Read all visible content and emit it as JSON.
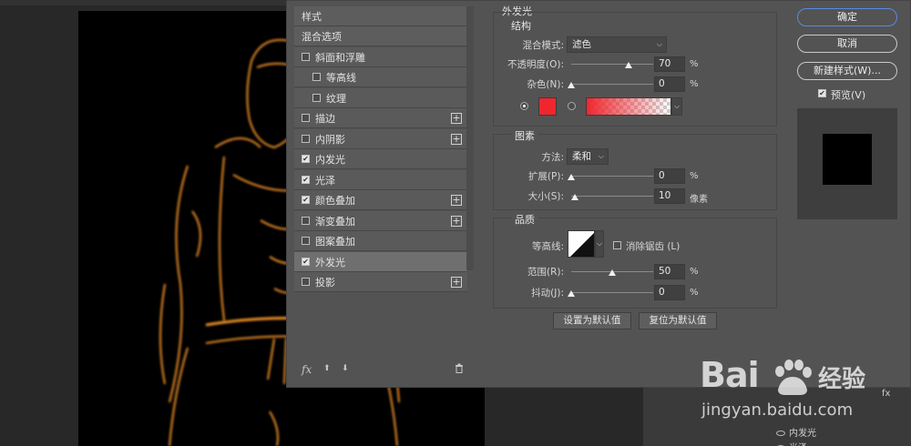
{
  "styles_list": {
    "items": [
      {
        "label": "样式",
        "type": "header"
      },
      {
        "label": "混合选项",
        "type": "header"
      },
      {
        "label": "斜面和浮雕",
        "checked": false,
        "plus": false,
        "indent": false
      },
      {
        "label": "等高线",
        "checked": false,
        "plus": false,
        "indent": true
      },
      {
        "label": "纹理",
        "checked": false,
        "plus": false,
        "indent": true
      },
      {
        "label": "描边",
        "checked": false,
        "plus": true,
        "indent": false
      },
      {
        "label": "内阴影",
        "checked": false,
        "plus": true,
        "indent": false
      },
      {
        "label": "内发光",
        "checked": true,
        "plus": false,
        "indent": false
      },
      {
        "label": "光泽",
        "checked": true,
        "plus": false,
        "indent": false
      },
      {
        "label": "颜色叠加",
        "checked": true,
        "plus": true,
        "indent": false
      },
      {
        "label": "渐变叠加",
        "checked": false,
        "plus": true,
        "indent": false
      },
      {
        "label": "图案叠加",
        "checked": false,
        "plus": false,
        "indent": false
      },
      {
        "label": "外发光",
        "checked": true,
        "plus": false,
        "indent": false,
        "selected": true
      },
      {
        "label": "投影",
        "checked": false,
        "plus": true,
        "indent": false
      }
    ],
    "footer": {
      "fx": "fx",
      "up": "⬆",
      "down": "⬇",
      "trash": "🗑"
    }
  },
  "panel": {
    "title": "外发光",
    "structure": {
      "title": "结构",
      "blend_mode_label": "混合模式:",
      "blend_mode_value": "滤色",
      "opacity_label": "不透明度(O):",
      "opacity_value": "70",
      "opacity_unit": "%",
      "opacity_level": 0.7,
      "noise_label": "杂色(N):",
      "noise_value": "0",
      "noise_unit": "%",
      "noise_level": 0,
      "color": "#f0262e",
      "gradient_from": "#f0262e",
      "solid_color_selected": true
    },
    "elements": {
      "title": "图素",
      "method_label": "方法:",
      "method_value": "柔和",
      "spread_label": "扩展(P):",
      "spread_value": "0",
      "spread_unit": "%",
      "spread_level": 0,
      "size_label": "大小(S):",
      "size_value": "10",
      "size_unit": "像素",
      "size_level": 0.04
    },
    "quality": {
      "title": "品质",
      "contour_label": "等高线:",
      "anti_alias_label": "消除锯齿 (L)",
      "anti_alias_checked": false,
      "range_label": "范围(R):",
      "range_value": "50",
      "range_unit": "%",
      "range_level": 0.5,
      "jitter_label": "抖动(J):",
      "jitter_value": "0",
      "jitter_unit": "%",
      "jitter_level": 0
    },
    "set_default_label": "设置为默认值",
    "reset_default_label": "复位为默认值"
  },
  "actions": {
    "ok_label": "确定",
    "cancel_label": "取消",
    "new_style_label": "新建样式(W)...",
    "preview_label": "预览(V)",
    "preview_checked": true
  },
  "layers": {
    "fx_label": "fx",
    "effects": [
      "内发光",
      "光泽"
    ]
  },
  "watermark": {
    "brand": "Bai",
    "brand_cn": "经验",
    "url": "jingyan.baidu.com"
  },
  "colors": {
    "dialog_bg": "#535353",
    "selected_row": "#6f6f6f",
    "primary_border": "#5a8ae0",
    "glow_orange": "#ff8c1a"
  }
}
